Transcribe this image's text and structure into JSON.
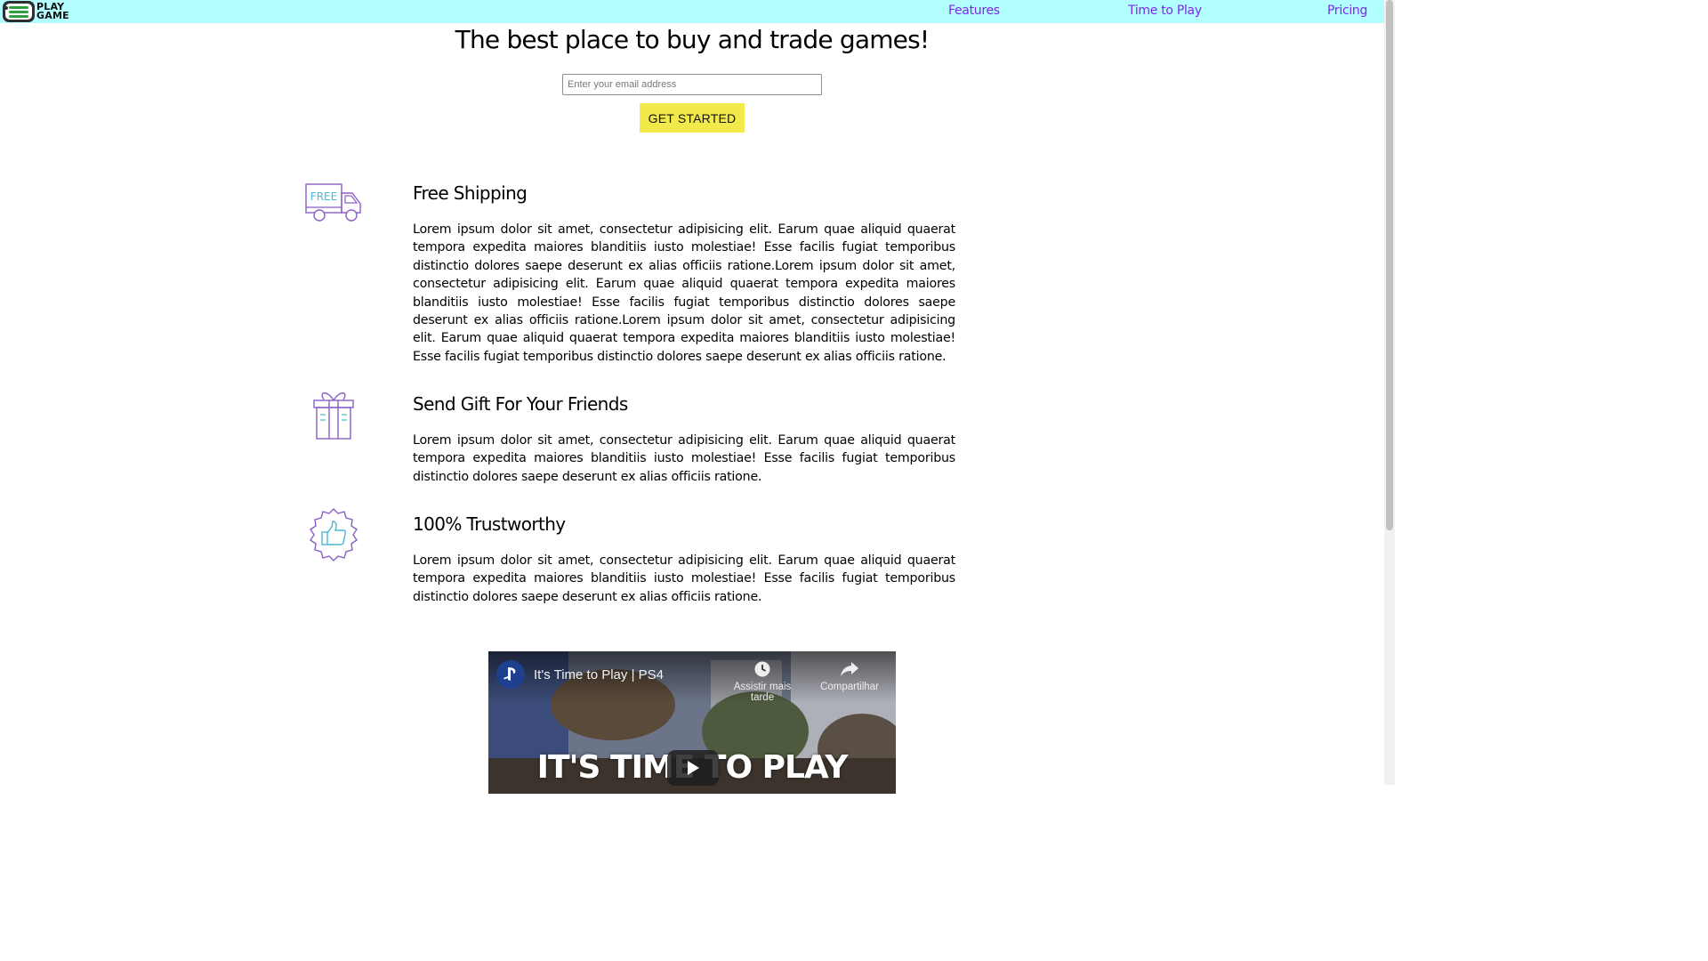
{
  "header": {
    "logo": {
      "line1": "PLAY",
      "line2": "GAME"
    },
    "nav": {
      "features": "Features",
      "time_to_play": "Time to Play",
      "pricing": "Pricing"
    }
  },
  "hero": {
    "title": "The best place to buy and trade games!",
    "email_placeholder": "Enter your email address",
    "cta_label": "GET STARTED"
  },
  "features": [
    {
      "icon": "free-shipping-truck-icon",
      "icon_badge": "FREE",
      "title": "Free Shipping",
      "text": "Lorem ipsum dolor sit amet, consectetur adipisicing elit. Earum quae aliquid quaerat tempora expedita maiores blanditiis iusto molestiae! Esse facilis fugiat temporibus distinctio dolores saepe deserunt ex alias officiis ratione.Lorem ipsum dolor sit amet, consectetur adipisicing elit. Earum quae aliquid quaerat tempora expedita maiores blanditiis iusto molestiae! Esse facilis fugiat temporibus distinctio dolores saepe deserunt ex alias officiis ratione.Lorem ipsum dolor sit amet, consectetur adipisicing elit. Earum quae aliquid quaerat tempora expedita maiores blanditiis iusto molestiae! Esse facilis fugiat temporibus distinctio dolores saepe deserunt ex alias officiis ratione."
    },
    {
      "icon": "gift-icon",
      "title": "Send Gift For Your Friends",
      "text": "Lorem ipsum dolor sit amet, consectetur adipisicing elit. Earum quae aliquid quaerat tempora expedita maiores blanditiis iusto molestiae! Esse facilis fugiat temporibus distinctio dolores saepe deserunt ex alias officiis ratione."
    },
    {
      "icon": "thumbs-up-badge-icon",
      "title": "100% Trustworthy",
      "text": "Lorem ipsum dolor sit amet, consectetur adipisicing elit. Earum quae aliquid quaerat tempora expedita maiores blanditiis iusto molestiae! Esse facilis fugiat temporibus distinctio dolores saepe deserunt ex alias officiis ratione."
    }
  ],
  "video": {
    "title": "It's Time to Play | PS4",
    "watch_later": "Assistir mais tarde",
    "share": "Compartilhar",
    "banner_text": "IT'S TIME TO PLAY",
    "channel_icon": "playstation-icon"
  },
  "colors": {
    "navbar_bg": "#b3ffff",
    "nav_link": "#7b2ae8",
    "cta_bg": "#f2ea4a",
    "icon_purple": "#8a5fc4",
    "icon_teal": "#4bb8d8"
  }
}
